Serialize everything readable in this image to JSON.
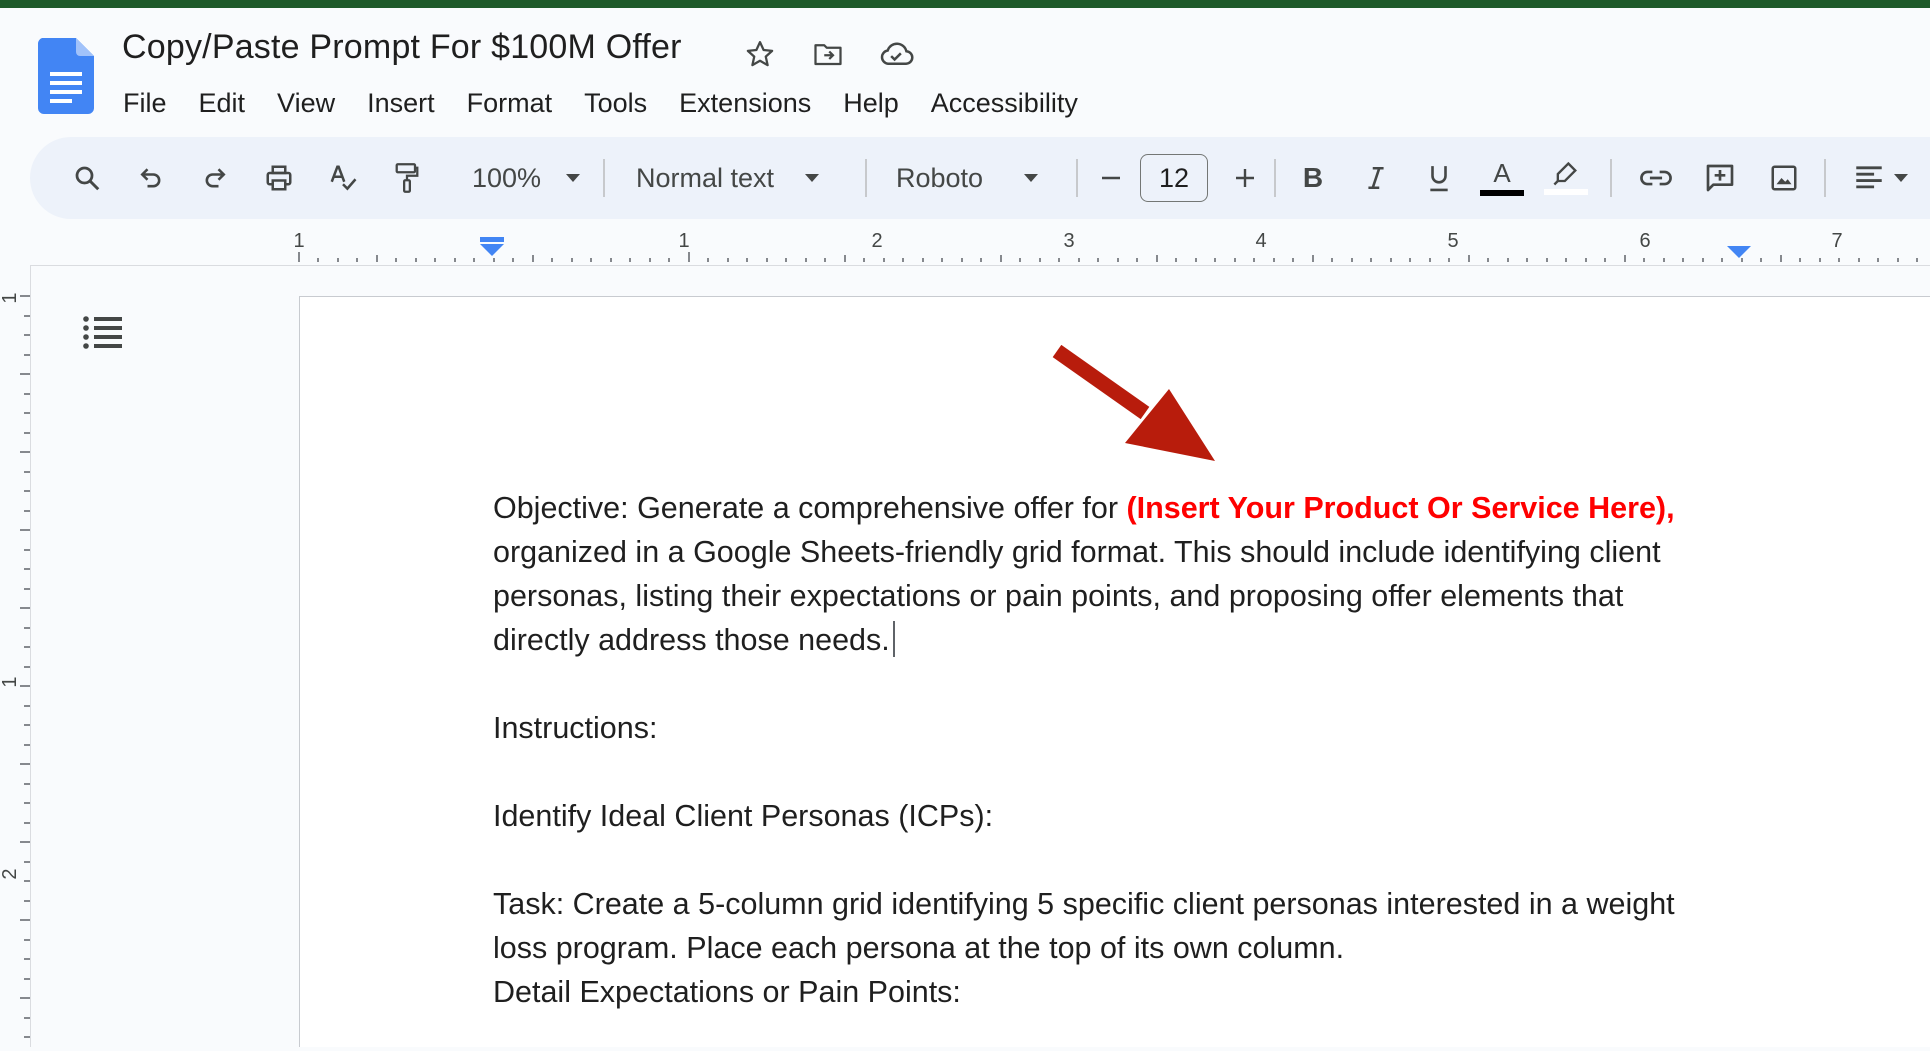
{
  "document": {
    "title": "Copy/Paste Prompt For $100M Offer"
  },
  "menu": {
    "items": [
      "File",
      "Edit",
      "View",
      "Insert",
      "Format",
      "Tools",
      "Extensions",
      "Help",
      "Accessibility"
    ]
  },
  "toolbar": {
    "zoom": "100%",
    "style": "Normal text",
    "font": "Roboto",
    "font_size": "12",
    "icons": [
      "search-icon",
      "undo-icon",
      "redo-icon",
      "print-icon",
      "spellcheck-icon",
      "paint-format-icon",
      "zoom-dropdown",
      "style-dropdown",
      "font-dropdown",
      "decrease-font-icon",
      "font-size-input",
      "increase-font-icon",
      "bold-icon",
      "italic-icon",
      "underline-icon",
      "text-color-icon",
      "highlight-icon",
      "link-icon",
      "comment-icon",
      "image-icon",
      "align-icon"
    ]
  },
  "ruler": {
    "h_labels": [
      "1",
      "1",
      "2",
      "3",
      "4",
      "5",
      "6",
      "7"
    ],
    "v_labels": [
      "1",
      "1",
      "2"
    ]
  },
  "content": {
    "p1_start": "Objective: Generate a comprehensive offer for ",
    "p1_red": "(Insert Your Product Or Service Here),",
    "p1_line2": "organized in a Google Sheets-friendly grid format. This should include identifying client",
    "p1_line3": "personas, listing their expectations or pain points, and proposing offer elements that",
    "p1_line4": "directly address those needs.",
    "p2": "Instructions:",
    "p3": "Identify Ideal Client Personas (ICPs):",
    "p4_line1": "Task: Create a 5-column grid identifying 5 specific client personas interested in a weight",
    "p4_line2": "loss program. Place each persona at the top of its own column.",
    "p5": "Detail Expectations or Pain Points:"
  },
  "colors": {
    "accent_red": "#ff0000",
    "arrow_red": "#b81c0c",
    "top_bar": "#1e5a2a",
    "toolbar_bg": "#edf2fa"
  }
}
